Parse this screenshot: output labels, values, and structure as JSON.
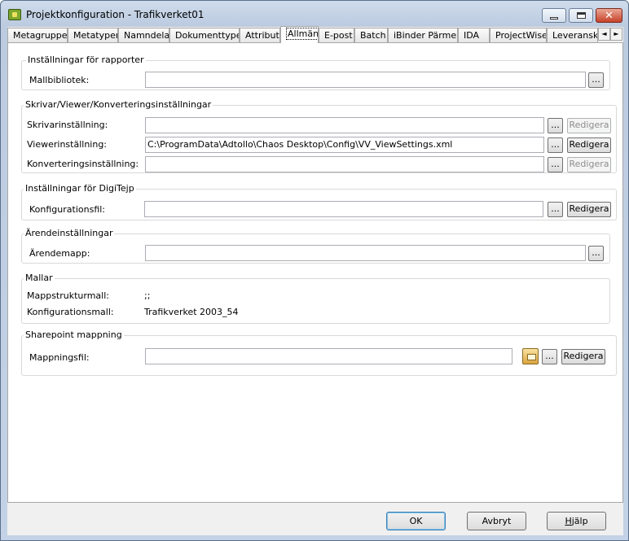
{
  "window": {
    "title": "Projektkonfiguration - Trafikverket01",
    "close_glyph": "✕"
  },
  "tabs": [
    {
      "label": "Metagrupper"
    },
    {
      "label": "Metatyper"
    },
    {
      "label": "Namndelar"
    },
    {
      "label": "Dokumenttyper"
    },
    {
      "label": "Attribut"
    },
    {
      "label": "Allmänt"
    },
    {
      "label": "E-post"
    },
    {
      "label": "Batch"
    },
    {
      "label": "iBinder Pärmen"
    },
    {
      "label": "IDA"
    },
    {
      "label": "ProjectWise"
    },
    {
      "label": "Leveransko"
    }
  ],
  "tab_scroll": {
    "left": "◄",
    "right": "►"
  },
  "groups": {
    "rapporter": {
      "title": "Inställningar för rapporter",
      "mallbibliotek_label": "Mallbibliotek:",
      "mallbibliotek_value": "",
      "browse": "..."
    },
    "skrivar": {
      "title": "Skrivar/Viewer/Konverteringsinställningar",
      "skrivar_label": "Skrivarinställning:",
      "skrivar_value": "",
      "viewer_label": "Viewerinställning:",
      "viewer_value": "C:\\ProgramData\\Adtollo\\Chaos Desktop\\Config\\VV_ViewSettings.xml",
      "konv_label": "Konverteringsinställning:",
      "konv_value": "",
      "browse": "...",
      "edit": "Redigera"
    },
    "digitejp": {
      "title": "Inställningar för DigiTejp",
      "konfig_label": "Konfigurationsfil:",
      "konfig_value": "",
      "browse": "...",
      "edit": "Redigera"
    },
    "arende": {
      "title": "Ärendeinställningar",
      "mapp_label": "Ärendemapp:",
      "mapp_value": "",
      "browse": "..."
    },
    "mallar": {
      "title": "Mallar",
      "mappstruktur_label": "Mappstrukturmall:",
      "mappstruktur_value": ";;",
      "konfigmall_label": "Konfigurationsmall:",
      "konfigmall_value": "Trafikverket 2003_54"
    },
    "sharepoint": {
      "title": "Sharepoint mappning",
      "mappning_label": "Mappningsfil:",
      "mappning_value": "",
      "browse": "...",
      "edit": "Redigera"
    }
  },
  "footer": {
    "ok": "OK",
    "cancel": "Avbryt",
    "help_mnemonic": "H",
    "help_rest": "jälp"
  }
}
